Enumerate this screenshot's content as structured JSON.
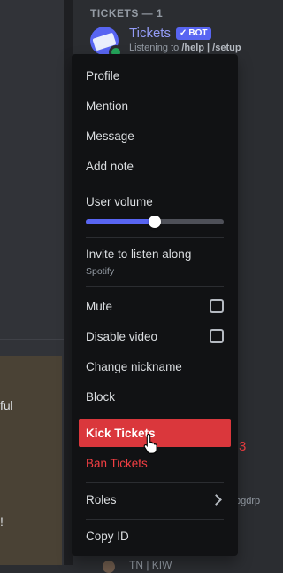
{
  "background": {
    "left_fragments": [
      "ful",
      "!"
    ],
    "member_list_header": "TICKETS — 1",
    "member": {
      "name": "Tickets",
      "bot_tag": "BOT",
      "activity_prefix": "Listening to ",
      "activity_detail": "/help | /setup"
    },
    "right_fragments": [
      "3",
      "bgdrp",
      "TN | KIW"
    ]
  },
  "menu": {
    "items_top": [
      "Profile",
      "Mention",
      "Message",
      "Add note"
    ],
    "volume": {
      "label": "User volume",
      "level_percent": 50
    },
    "listen": {
      "title": "Invite to listen along",
      "subtitle": "Spotify"
    },
    "mute_label": "Mute",
    "disable_video_label": "Disable video",
    "change_nickname_label": "Change nickname",
    "block_label": "Block",
    "kick_label": "Kick Tickets",
    "ban_label": "Ban Tickets",
    "roles_label": "Roles",
    "copy_id_label": "Copy ID"
  },
  "colors": {
    "accent": "#5865f2",
    "danger": "#da373c",
    "danger_text": "#f23f43",
    "online": "#23a55a",
    "menu_bg": "#111214"
  }
}
